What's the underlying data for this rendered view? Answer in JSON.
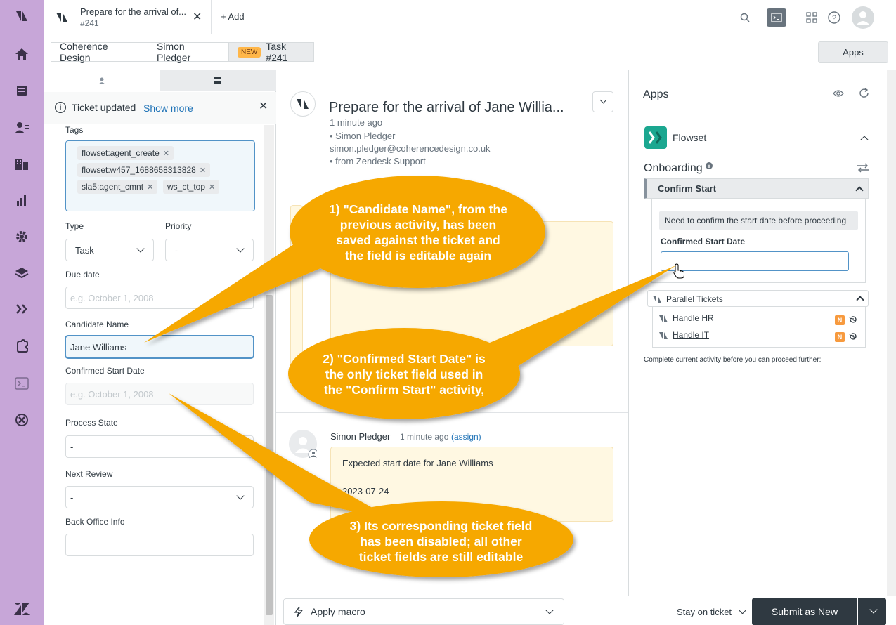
{
  "tab": {
    "title": "Prepare for the arrival of...",
    "subtitle": "#241",
    "add_label": "+ Add"
  },
  "breadcrumbs": [
    {
      "label": "Coherence Design"
    },
    {
      "label": "Simon Pledger"
    },
    {
      "badge": "NEW",
      "label": "Task #241"
    }
  ],
  "apps_button": "Apps",
  "notice": {
    "title": "Ticket updated",
    "link": "Show more"
  },
  "fields": {
    "tags_label": "Tags",
    "tags": [
      "flowset:agent_create",
      "flowset:w457_1688658313828",
      "sla5:agent_cmnt",
      "ws_ct_top"
    ],
    "type_label": "Type",
    "type_value": "Task",
    "priority_label": "Priority",
    "priority_value": "-",
    "due_label": "Due date",
    "due_placeholder": "e.g. October 1, 2008",
    "candidate_label": "Candidate Name",
    "candidate_value": "Jane Williams",
    "csd_label": "Confirmed Start Date",
    "csd_placeholder": "e.g. October 1, 2008",
    "process_label": "Process State",
    "process_value": "-",
    "review_label": "Next Review",
    "review_value": "-",
    "backoffice_label": "Back Office Info",
    "backoffice_value": ""
  },
  "conversation": {
    "title": "Prepare for the arrival of Jane Willia...",
    "time": "1 minute ago",
    "author": "• Simon Pledger",
    "email": "simon.pledger@coherencedesign.co.uk",
    "source": "• from Zendesk Support",
    "message": {
      "author": "Simon Pledger",
      "time": "1 minute ago",
      "assign": "(assign)",
      "line1": "Expected start date for Jane Williams",
      "line2": "2023-07-24"
    }
  },
  "apps_panel": {
    "title": "Apps",
    "app_name": "Flowset",
    "section": "Onboarding",
    "activity": "Confirm Start",
    "note": "Need to confirm the start date before proceeding",
    "csd_label": "Confirmed Start Date",
    "parallel_title": "Parallel Tickets",
    "parallel": [
      {
        "label": "Handle HR",
        "badge": "N"
      },
      {
        "label": "Handle IT",
        "badge": "N"
      }
    ],
    "footer": "Complete current activity before you can proceed further:"
  },
  "bottom": {
    "macro": "Apply macro",
    "stay": "Stay on ticket",
    "submit": "Submit as New"
  },
  "callouts": [
    {
      "lines": [
        "1) \"Candidate Name\", from the",
        "previous activity, has been",
        "saved against the ticket and",
        "the field is editable again"
      ]
    },
    {
      "lines": [
        "2) \"Confirmed Start Date\" is",
        "the only ticket field used in",
        "the \"Confirm Start\" activity,"
      ]
    },
    {
      "lines": [
        "3) Its corresponding ticket field",
        "has been disabled; all other",
        "ticket fields are still editable"
      ]
    }
  ],
  "colors": {
    "nav": "#c7a6d8",
    "callout": "#f6a800",
    "submit": "#2f3941",
    "flowset": "#1ba790"
  }
}
